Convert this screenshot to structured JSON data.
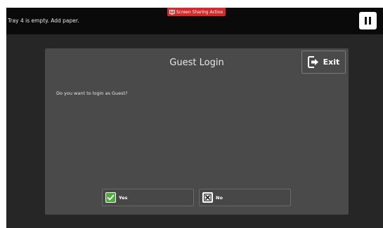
{
  "status_bar": {
    "message": "Tray 4 is empty.  Add paper.",
    "sharing_badge": "Screen Sharing Active",
    "pause_icon": "pause-icon"
  },
  "dialog": {
    "title": "Guest Login",
    "exit_label": "Exit",
    "exit_icon": "exit-icon",
    "question": "Do you want to login as Guest?",
    "yes_label": "Yes",
    "yes_icon": "check-icon",
    "no_label": "No",
    "no_icon": "x-icon"
  },
  "colors": {
    "screen_background": "#262626",
    "status_bar": "#0a0a0a",
    "dialog_background": "#4a4a4a",
    "badge_red": "#d62a2a",
    "check_green": "#4cae3a"
  }
}
